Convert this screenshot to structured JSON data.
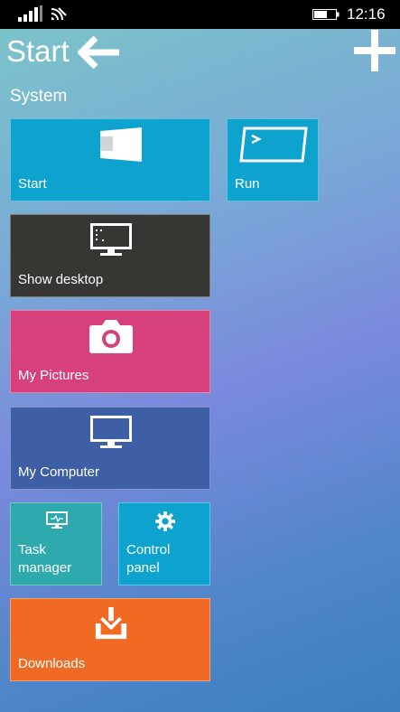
{
  "status_bar": {
    "time": "12:16"
  },
  "header": {
    "title": "Start"
  },
  "section": {
    "label": "System"
  },
  "tiles": [
    {
      "label": "Start",
      "icon": "start-window-icon",
      "color": "#0ea3cf"
    },
    {
      "label": "Run",
      "icon": "run-prompt-icon",
      "color": "#0ea3cf"
    },
    {
      "label": "Show desktop",
      "icon": "monitor-desktop-icon",
      "color": "#373632"
    },
    {
      "label": "My Pictures",
      "icon": "camera-icon",
      "color": "#d6407d"
    },
    {
      "label": "My Computer",
      "icon": "monitor-icon",
      "color": "#3e5fa6"
    },
    {
      "label": "Task manager",
      "icon": "task-monitor-icon",
      "color": "#2ea9ad"
    },
    {
      "label": "Control panel",
      "icon": "gear-icon",
      "color": "#0ea3cf"
    },
    {
      "label": "Downloads",
      "icon": "download-tray-icon",
      "color": "#f06a23"
    }
  ]
}
